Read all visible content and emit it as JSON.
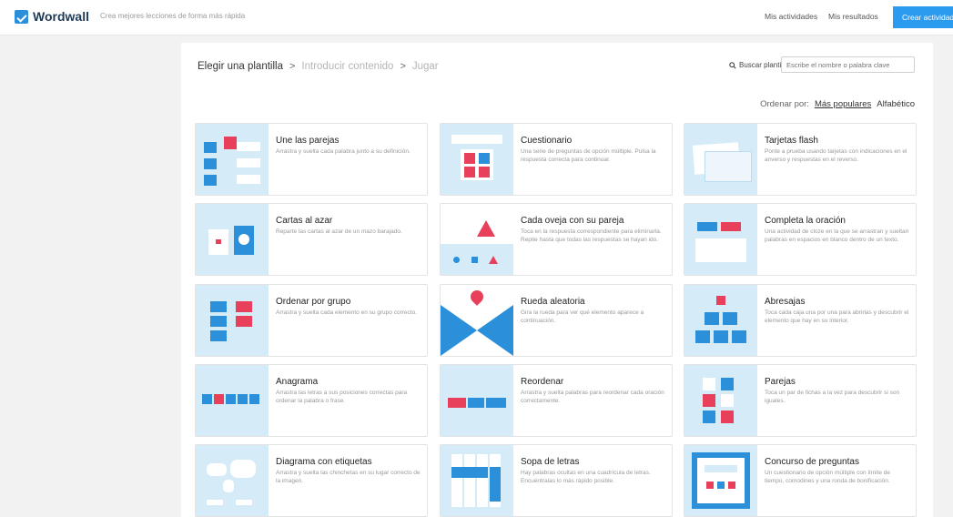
{
  "app": {
    "brand": "Wordwall",
    "tagline": "Crea mejores lecciones de forma más rápida"
  },
  "nav": {
    "activities": "Mis actividades",
    "results": "Mis resultados",
    "create": "Crear actividad"
  },
  "breadcrumb": {
    "step1": "Elegir una plantilla",
    "step2": "Introducir contenido",
    "step3": "Jugar"
  },
  "search": {
    "label": "Buscar plantillas",
    "placeholder": "Escribe el nombre o palabra clave"
  },
  "sort": {
    "label": "Ordenar por:",
    "popular": "Más populares",
    "alpha": "Alfabético"
  },
  "colors": {
    "accent": "#2b9bf0",
    "thumb_bg": "#d6ebf8",
    "blue": "#2b8fd9",
    "red": "#e8405a"
  },
  "templates": [
    {
      "title": "Une las parejas",
      "desc": "Arrastra y suelta cada palabra junto a su definición.",
      "icon": "match-up-icon"
    },
    {
      "title": "Cuestionario",
      "desc": "Una serie de preguntas de opción múltiple. Pulsa la respuesta correcta para continuar.",
      "icon": "quiz-icon"
    },
    {
      "title": "Tarjetas flash",
      "desc": "Ponte a prueba usando tarjetas con indicaciones en el anverso y respuestas en el reverso.",
      "icon": "flash-cards-icon"
    },
    {
      "title": "Cartas al azar",
      "desc": "Reparte las cartas al azar de un mazo barajado.",
      "icon": "random-cards-icon"
    },
    {
      "title": "Cada oveja con su pareja",
      "desc": "Toca en la respuesta correspondiente para eliminarla. Repite hasta que todas las respuestas se hayan ido.",
      "icon": "find-match-icon"
    },
    {
      "title": "Completa la oración",
      "desc": "Una actividad de cloze en la que se arrastran y sueltan palabras en espacios en blanco dentro de un texto.",
      "icon": "complete-sentence-icon"
    },
    {
      "title": "Ordenar por grupo",
      "desc": "Arrastra y suelta cada elemento en su grupo correcto.",
      "icon": "group-sort-icon"
    },
    {
      "title": "Rueda aleatoria",
      "desc": "Gira la rueda para ver qué elemento aparece a continuación.",
      "icon": "spin-wheel-icon"
    },
    {
      "title": "Abresajas",
      "desc": "Toca cada caja una por una para abrirlas y descubrir el elemento que hay en su interior.",
      "icon": "open-box-icon"
    },
    {
      "title": "Anagrama",
      "desc": "Arrastra las letras a sus posiciones correctas para ordenar la palabra o frase.",
      "icon": "anagram-icon"
    },
    {
      "title": "Reordenar",
      "desc": "Arrastra y suelta palabras para reordenar cada oración correctamente.",
      "icon": "unjumble-icon"
    },
    {
      "title": "Parejas",
      "desc": "Toca un par de fichas a la vez para descubrir si son iguales.",
      "icon": "matching-pairs-icon"
    },
    {
      "title": "Diagrama con etiquetas",
      "desc": "Arrastra y suelta las chinchetas en su lugar correcto de la imagen.",
      "icon": "labelled-diagram-icon"
    },
    {
      "title": "Sopa de letras",
      "desc": "Hay palabras ocultas en una cuadrícula de letras. Encuéntralas lo más rápido posible.",
      "icon": "wordsearch-icon"
    },
    {
      "title": "Concurso de preguntas",
      "desc": "Un cuestionario de opción múltiple con límite de tiempo, comodines y una ronda de bonificación.",
      "icon": "gameshow-quiz-icon"
    }
  ]
}
